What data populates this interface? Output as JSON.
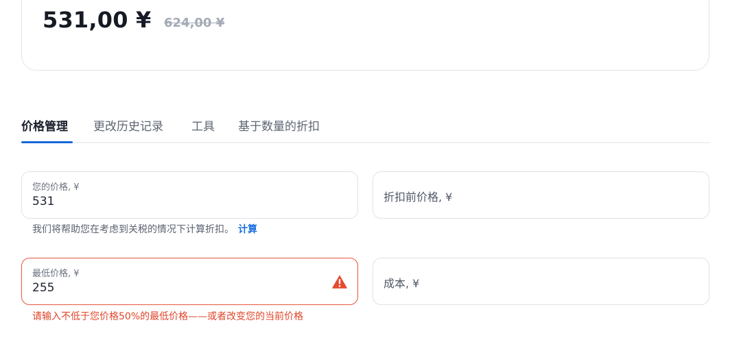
{
  "price_card": {
    "current_price": "531,00 ¥",
    "old_price": "624,00 ¥"
  },
  "tabs": [
    {
      "label": "价格管理",
      "active": true
    },
    {
      "label": "更改历史记录",
      "active": false
    },
    {
      "label": "工具",
      "active": false
    },
    {
      "label": "基于数量的折扣",
      "active": false
    }
  ],
  "form": {
    "your_price": {
      "label": "您的价格, ¥",
      "value": "531"
    },
    "price_before_discount": {
      "label": "折扣前价格, ¥"
    },
    "hint": {
      "text": "我们将帮助您在考虑到关税的情况下计算折扣。",
      "link": "计算"
    },
    "min_price": {
      "label": "最低价格, ¥",
      "value": "255",
      "icon": "warning-icon",
      "error_color": "#e8533c"
    },
    "cost": {
      "label": "成本, ¥"
    },
    "error_message": "请输入不低于您价格50%的最低价格——或者改变您的当前价格"
  },
  "colors": {
    "accent": "#1668d9",
    "error": "#e0452a"
  }
}
